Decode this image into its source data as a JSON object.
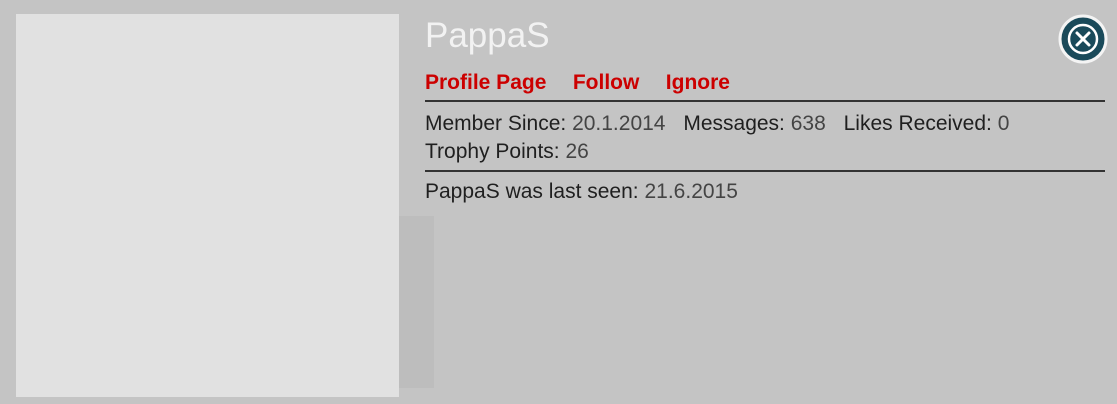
{
  "profile": {
    "username": "PappaS",
    "links": {
      "profile_page": "Profile Page",
      "follow": "Follow",
      "ignore": "Ignore"
    },
    "stats": {
      "member_since_label": "Member Since:",
      "member_since_value": "20.1.2014",
      "messages_label": "Messages:",
      "messages_value": "638",
      "likes_label": "Likes Received:",
      "likes_value": "0",
      "trophy_label": "Trophy Points:",
      "trophy_value": "26"
    },
    "last_seen_label": "PappaS was last seen:",
    "last_seen_value": "21.6.2015"
  },
  "icons": {
    "close": "close-icon"
  },
  "colors": {
    "link": "#cc0000",
    "username": "#f2f2f2",
    "avatar_placeholder": "#e1e1e1",
    "overlay": "#c4c4c4",
    "close_button": "#1a4a5a"
  }
}
